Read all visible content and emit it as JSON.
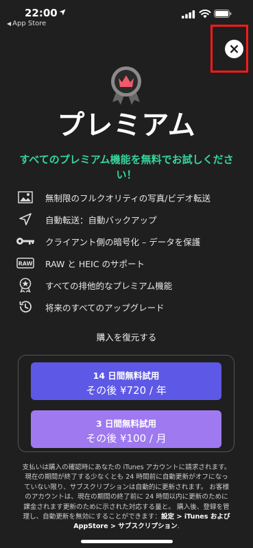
{
  "status_bar": {
    "time": "22:00",
    "back_app": "App Store"
  },
  "title": "プレミアム",
  "subtitle": "すべてのプレミアム機能を無料でお試しください！",
  "features": [
    {
      "icon": "photo-icon",
      "text": "無制限のフルクオリティの写真/ビデオ転送"
    },
    {
      "icon": "navigation-arrow-icon",
      "text": "自動転送：自動バックアップ"
    },
    {
      "icon": "key-icon",
      "text": "クライアント側の暗号化 – データを保護"
    },
    {
      "icon": "raw-icon",
      "text": "RAW と HEIC のサポート"
    },
    {
      "icon": "award-icon",
      "text": "すべての排他的なプレミアム機能"
    },
    {
      "icon": "history-clock-icon",
      "text": "将来のすべてのアップグレード"
    }
  ],
  "restore_label": "購入を復元する",
  "plans": [
    {
      "trial": "14 日間無料試用",
      "price": "その後 ¥720 / 年",
      "color": "#5e58e6"
    },
    {
      "trial": "3 日間無料試用",
      "price": "その後 ¥100 / 月",
      "color": "#9f79f0"
    }
  ],
  "legal": {
    "text": "支払いは購入の確認時にあなたの iTunes アカウントに請求されます。 現在の期間が終了する少なくとも 24 時間前に自動更新がオフになっていない限り、サブスクリプションは自動的に更新されます。 お客様のアカウントは、現在の期間の終了前に 24 時間以内に更新のために課金されます更新のために示された対応する量と。 購入後、登録を管理し、自動更新を無効にすることができます：",
    "path": "設定 > iTunes および AppStore > サブスクリプション"
  },
  "colors": {
    "background": "#1f1f1f",
    "accent_green": "#35d59a",
    "highlight": "#ff1a1a"
  }
}
